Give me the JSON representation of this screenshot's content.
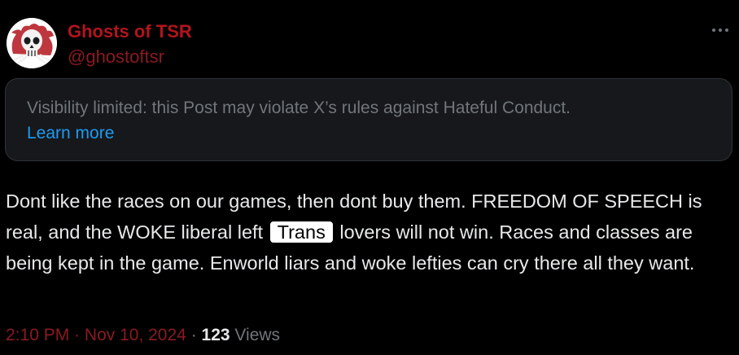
{
  "author": {
    "display_name": "Ghosts of TSR",
    "handle": "@ghostoftsr",
    "avatar_icon": "skull-icon"
  },
  "menu": {
    "icon": "more-horizontal-icon"
  },
  "notice": {
    "text": "Visibility limited: this Post may violate X’s rules against Hateful Conduct.",
    "link_label": "Learn more"
  },
  "post": {
    "text_before": "Dont like the races on our games, then dont buy them. FREEDOM OF SPEECH is real, and the WOKE liberal left",
    "redacted_word": "Trans",
    "text_after": "lovers will not win. Races and classes are being kept in the game. Enworld liars and woke lefties can cry there all they want."
  },
  "meta": {
    "time": "2:10 PM",
    "separator": "·",
    "date": "Nov 10, 2024",
    "views_count": "123",
    "views_label": "Views"
  },
  "colors": {
    "background": "#000000",
    "name_red": "#b3141c",
    "handle_red": "#8b1a1f",
    "link_blue": "#1d9bf0",
    "muted_gray": "#71767b",
    "notice_bg": "#16181c"
  }
}
